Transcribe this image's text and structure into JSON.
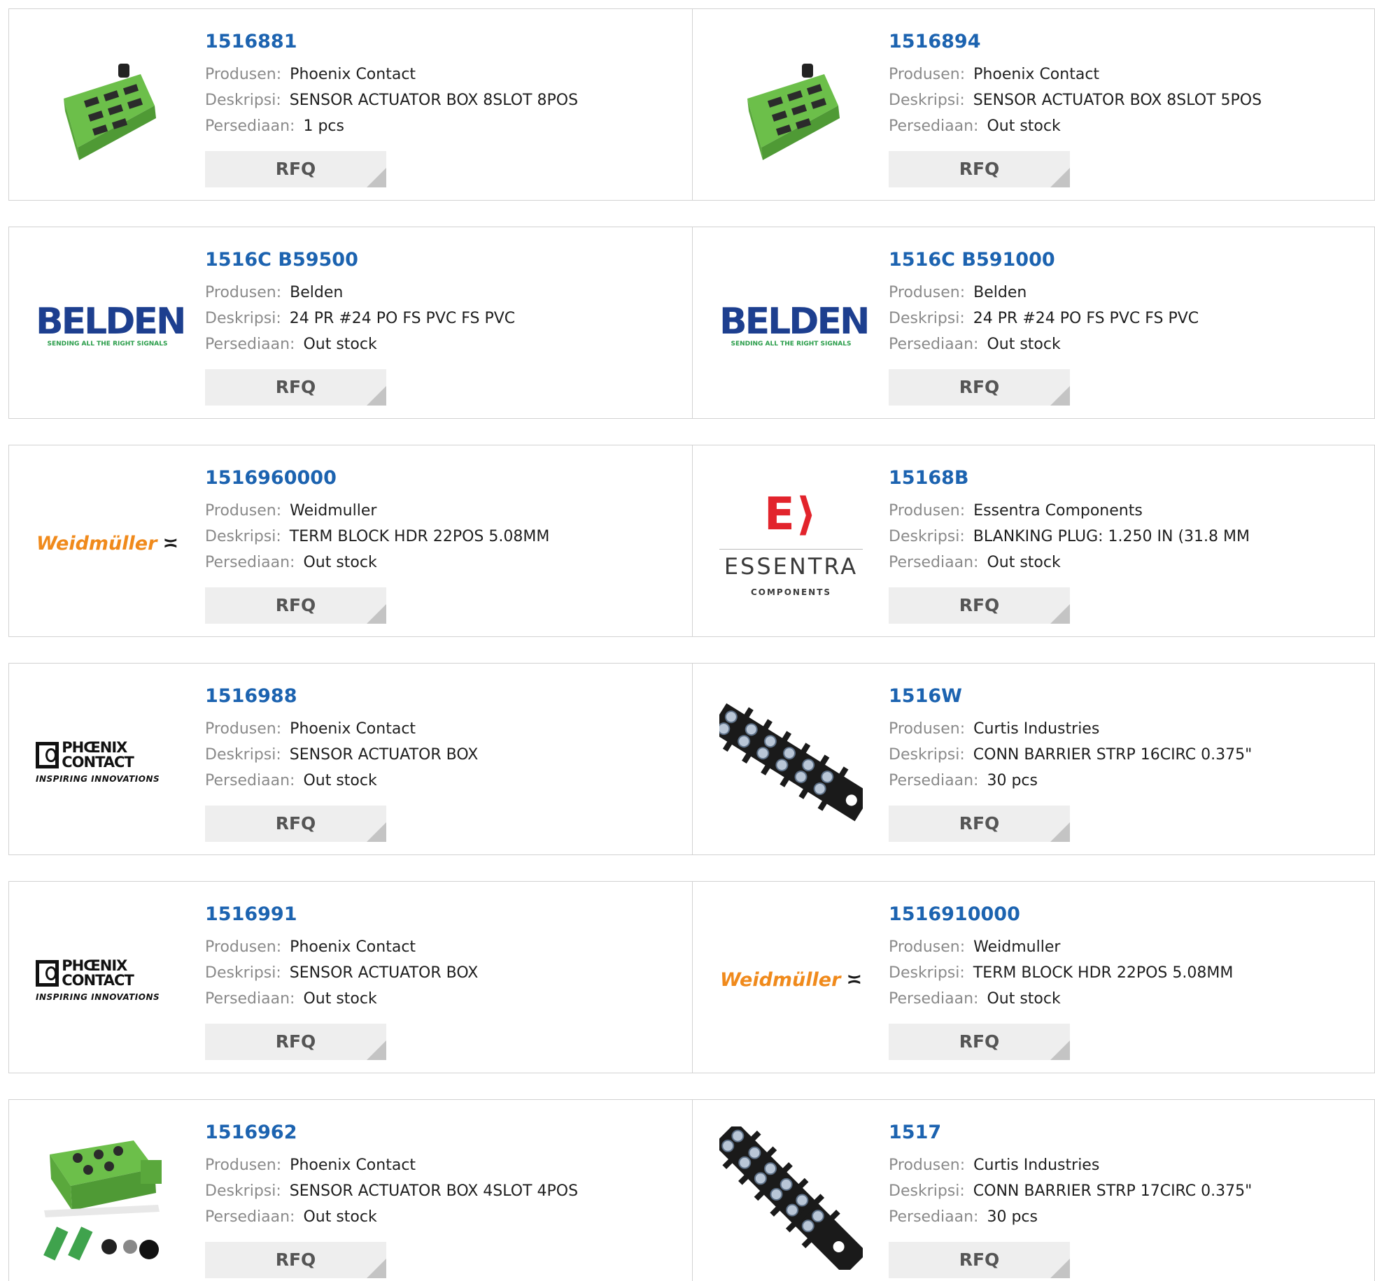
{
  "labels": {
    "manufacturer": "Produsen:",
    "description": "Deskripsi:",
    "stock": "Persediaan:",
    "rfq": "RFQ"
  },
  "products": [
    {
      "part": "1516881",
      "manufacturer": "Phoenix Contact",
      "description": "SENSOR ACTUATOR BOX 8SLOT 8POS",
      "stock": "1 pcs",
      "image": "green-sensor-box-photo"
    },
    {
      "part": "1516894",
      "manufacturer": "Phoenix Contact",
      "description": "SENSOR ACTUATOR BOX 8SLOT 5POS",
      "stock": "Out stock",
      "image": "green-sensor-box-photo"
    },
    {
      "part": "1516C B59500",
      "manufacturer": "Belden",
      "description": "24 PR #24 PO FS PVC FS PVC",
      "stock": "Out stock",
      "image": "belden-logo",
      "logo_text": "BELDEN",
      "logo_tagline": "SENDING ALL THE RIGHT SIGNALS"
    },
    {
      "part": "1516C B591000",
      "manufacturer": "Belden",
      "description": "24 PR #24 PO FS PVC FS PVC",
      "stock": "Out stock",
      "image": "belden-logo",
      "logo_text": "BELDEN",
      "logo_tagline": "SENDING ALL THE RIGHT SIGNALS"
    },
    {
      "part": "1516960000",
      "manufacturer": "Weidmuller",
      "description": "TERM BLOCK HDR 22POS 5.08MM",
      "stock": "Out stock",
      "image": "weidmuller-logo",
      "logo_text": "Weidmüller"
    },
    {
      "part": "15168B",
      "manufacturer": "Essentra Components",
      "description": "BLANKING PLUG: 1.250 IN (31.8 MM",
      "stock": "Out stock",
      "image": "essentra-logo",
      "logo_text": "ESSENTRA",
      "logo_tagline": "COMPONENTS"
    },
    {
      "part": "1516988",
      "manufacturer": "Phoenix Contact",
      "description": "SENSOR ACTUATOR BOX",
      "stock": "Out stock",
      "image": "phoenix-contact-logo",
      "logo_text": "PHŒNIX CONTACT",
      "logo_tagline": "INSPIRING INNOVATIONS"
    },
    {
      "part": "1516W",
      "manufacturer": "Curtis Industries",
      "description": "CONN BARRIER STRP 16CIRC 0.375\"",
      "stock": "30 pcs",
      "image": "barrier-strip-photo"
    },
    {
      "part": "1516991",
      "manufacturer": "Phoenix Contact",
      "description": "SENSOR ACTUATOR BOX",
      "stock": "Out stock",
      "image": "phoenix-contact-logo",
      "logo_text": "PHŒNIX CONTACT",
      "logo_tagline": "INSPIRING INNOVATIONS"
    },
    {
      "part": "1516910000",
      "manufacturer": "Weidmuller",
      "description": "TERM BLOCK HDR 22POS 5.08MM",
      "stock": "Out stock",
      "image": "weidmuller-logo",
      "logo_text": "Weidmüller"
    },
    {
      "part": "1516962",
      "manufacturer": "Phoenix Contact",
      "description": "SENSOR ACTUATOR BOX 4SLOT 4POS",
      "stock": "Out stock",
      "image": "green-sensor-box-kit-photo"
    },
    {
      "part": "1517",
      "manufacturer": "Curtis Industries",
      "description": "CONN BARRIER STRP 17CIRC 0.375\"",
      "stock": "30 pcs",
      "image": "barrier-strip-photo"
    }
  ],
  "colors": {
    "part_link": "#1c63b0",
    "label": "#8a8a8a",
    "border": "#d2d2d2",
    "rfq_bg": "#eeeeee",
    "green_product": "#6cbf4a",
    "belden_blue": "#1d3f8f",
    "weidmuller_orange": "#f08a1c",
    "essentra_red": "#e2242c"
  }
}
